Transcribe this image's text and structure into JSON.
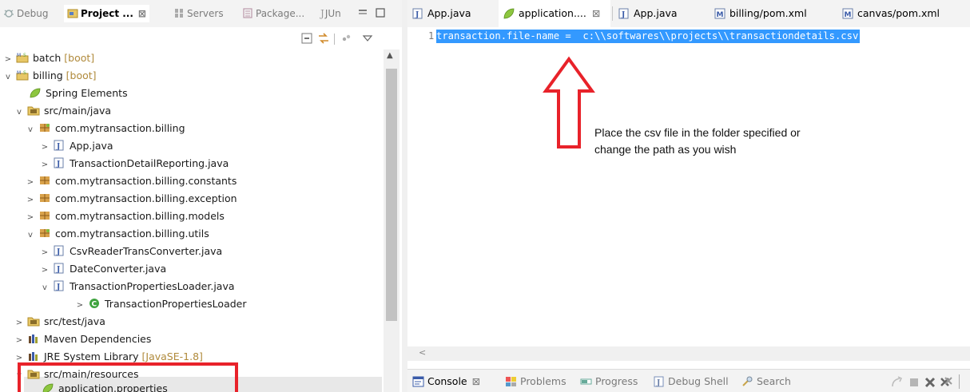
{
  "left_tabs": [
    {
      "label": "Debug",
      "icon": "debug-icon",
      "active": false
    },
    {
      "label": "Project ...",
      "icon": "project-explorer-icon",
      "active": true
    },
    {
      "label": "Servers",
      "icon": "servers-icon",
      "active": false
    },
    {
      "label": "Package...",
      "icon": "package-explorer-icon",
      "active": false
    },
    {
      "label": "JUn",
      "icon": "junit-icon",
      "active": false
    }
  ],
  "tab_close_glyph": "⊠",
  "tree": [
    {
      "label": "batch",
      "suffix": "[boot]",
      "icon": "maven-spring-project-icon",
      "twisty": ">"
    },
    {
      "label": "billing",
      "suffix": "[boot]",
      "icon": "maven-spring-project-icon",
      "twisty": "v"
    },
    {
      "label": "Spring Elements",
      "suffix": "",
      "icon": "spring-leaf-icon",
      "twisty": ""
    },
    {
      "label": "src/main/java",
      "suffix": "",
      "icon": "source-folder-icon",
      "twisty": "v"
    },
    {
      "label": "com.mytransaction.billing",
      "suffix": "",
      "icon": "package-icon",
      "twisty": "v"
    },
    {
      "label": "App.java",
      "suffix": "",
      "icon": "java-file-icon",
      "twisty": ">"
    },
    {
      "label": "TransactionDetailReporting.java",
      "suffix": "",
      "icon": "java-file-icon",
      "twisty": ">"
    },
    {
      "label": "com.mytransaction.billing.constants",
      "suffix": "",
      "icon": "package-icon",
      "twisty": ">"
    },
    {
      "label": "com.mytransaction.billing.exception",
      "suffix": "",
      "icon": "package-icon",
      "twisty": ">"
    },
    {
      "label": "com.mytransaction.billing.models",
      "suffix": "",
      "icon": "package-icon",
      "twisty": ">"
    },
    {
      "label": "com.mytransaction.billing.utils",
      "suffix": "",
      "icon": "package-icon",
      "twisty": "v"
    },
    {
      "label": "CsvReaderTransConverter.java",
      "suffix": "",
      "icon": "java-file-icon",
      "twisty": ">"
    },
    {
      "label": "DateConverter.java",
      "suffix": "",
      "icon": "java-file-icon",
      "twisty": ">"
    },
    {
      "label": "TransactionPropertiesLoader.java",
      "suffix": "",
      "icon": "java-file-icon",
      "twisty": "v"
    },
    {
      "label": "TransactionPropertiesLoader",
      "suffix": "",
      "icon": "class-icon",
      "twisty": ">"
    },
    {
      "label": "src/test/java",
      "suffix": "",
      "icon": "source-folder-icon",
      "twisty": ">"
    },
    {
      "label": "Maven Dependencies",
      "suffix": "",
      "icon": "library-icon",
      "twisty": ">"
    },
    {
      "label": "JRE System Library",
      "suffix": "[JavaSE-1.8]",
      "icon": "library-icon",
      "twisty": ">"
    },
    {
      "label": "src/main/resources",
      "suffix": "",
      "icon": "source-folder-icon",
      "twisty": "v"
    },
    {
      "label": "application.properties",
      "suffix": "",
      "icon": "spring-leaf-icon",
      "twisty": ""
    }
  ],
  "editor_tabs": [
    {
      "label": "App.java",
      "icon": "java-file-icon",
      "active": false
    },
    {
      "label": "application....",
      "icon": "spring-leaf-icon",
      "active": true
    },
    {
      "label": "App.java",
      "icon": "java-file-icon",
      "active": false
    },
    {
      "label": "billing/pom.xml",
      "icon": "maven-pom-icon",
      "active": false
    },
    {
      "label": "canvas/pom.xml",
      "icon": "maven-pom-icon",
      "active": false
    }
  ],
  "editor": {
    "line_number": "1",
    "code": "transaction.file-name =  c:\\\\softwares\\\\projects\\\\transactiondetails.csv",
    "annotation_line1": "Place the csv file in the folder specified or",
    "annotation_line2": "change the path as you wish"
  },
  "console_tabs": [
    {
      "label": "Console",
      "icon": "console-icon",
      "active": true
    },
    {
      "label": "Problems",
      "icon": "problems-icon",
      "active": false
    },
    {
      "label": "Progress",
      "icon": "progress-icon",
      "active": false
    },
    {
      "label": "Debug Shell",
      "icon": "debug-shell-icon",
      "active": false
    },
    {
      "label": "Search",
      "icon": "search-icon",
      "active": false
    }
  ],
  "colors": {
    "selection": "#3399ff",
    "annotation_red": "#e8222a",
    "boot_suffix": "#b08a3b"
  }
}
